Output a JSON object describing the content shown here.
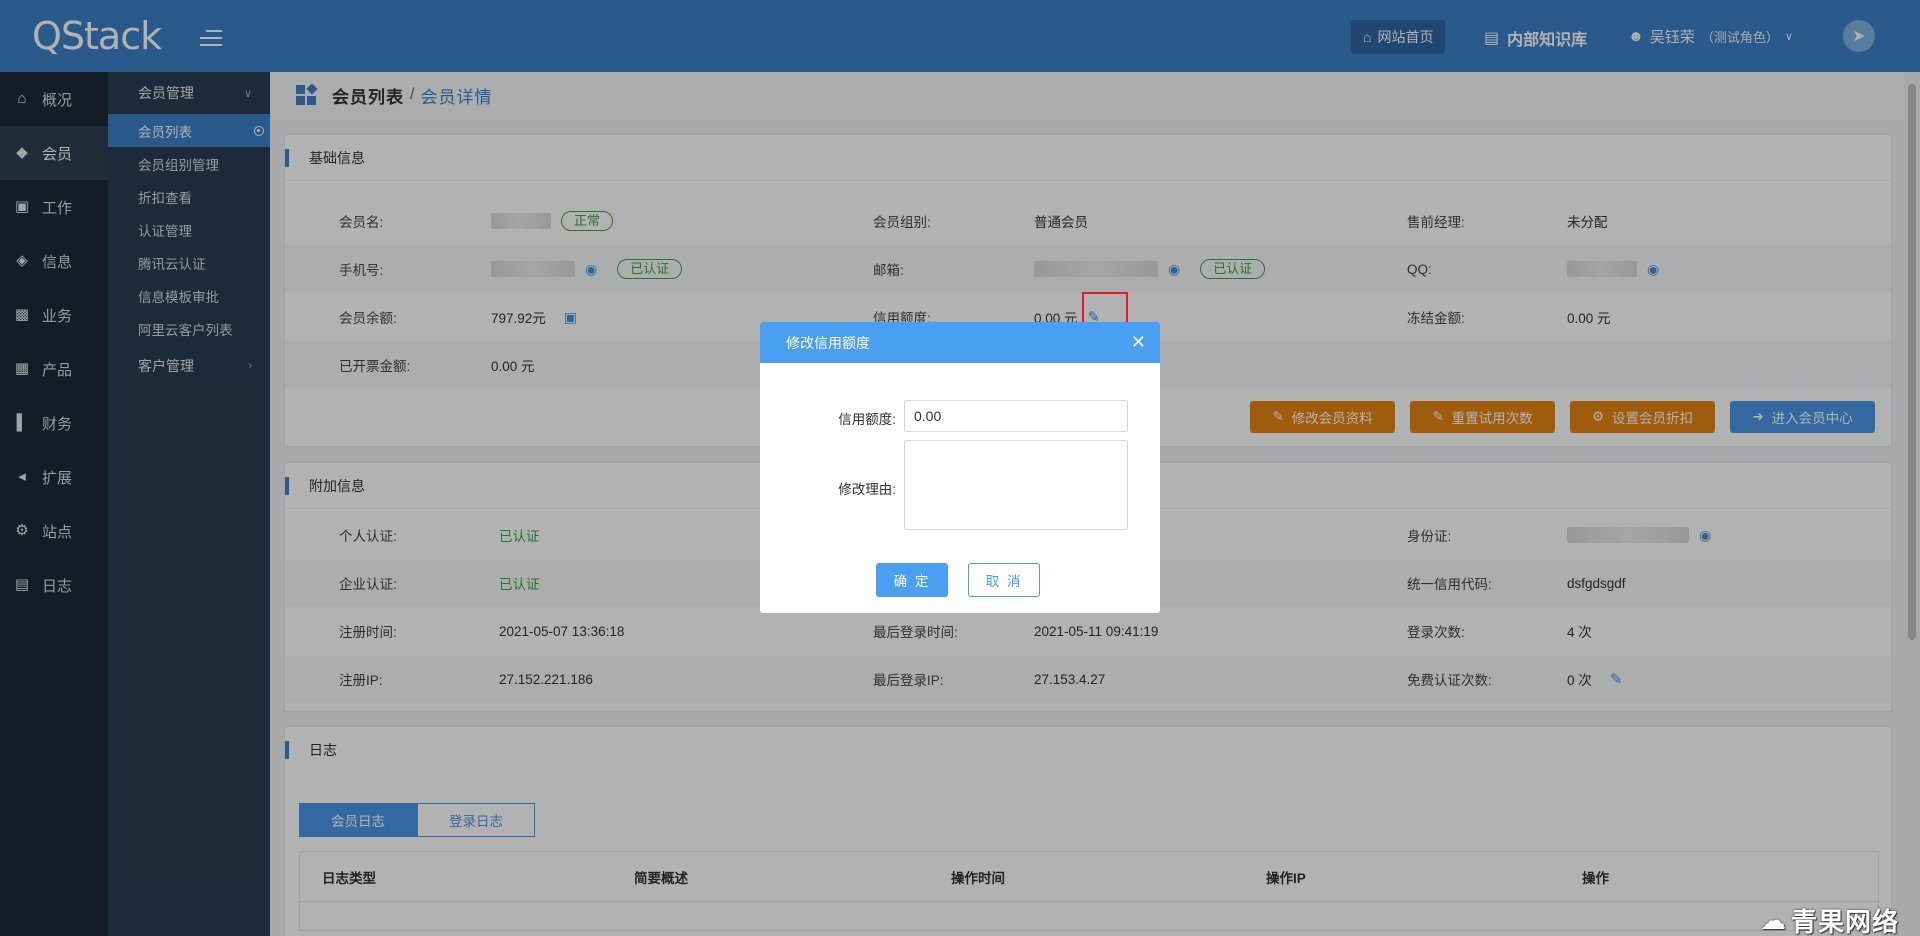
{
  "header": {
    "logo": "QStack",
    "home_button": "网站首页",
    "kb_link": "内部知识库",
    "user_name": "吴钰荣",
    "user_role": "（测试角色）"
  },
  "nav": {
    "items": [
      {
        "label": "概况",
        "icon": "home-icon"
      },
      {
        "label": "会员",
        "icon": "diamond-icon"
      },
      {
        "label": "工作",
        "icon": "clipboard-icon"
      },
      {
        "label": "信息",
        "icon": "cube-icon"
      },
      {
        "label": "业务",
        "icon": "briefcase-icon"
      },
      {
        "label": "产品",
        "icon": "cubes-icon"
      },
      {
        "label": "财务",
        "icon": "chart-icon"
      },
      {
        "label": "扩展",
        "icon": "arrows-icon"
      },
      {
        "label": "站点",
        "icon": "gear-icon"
      },
      {
        "label": "日志",
        "icon": "log-icon"
      }
    ]
  },
  "submenu": {
    "group1": "会员管理",
    "items": [
      "会员列表",
      "会员组别管理",
      "折扣查看",
      "认证管理",
      "腾讯云认证",
      "信息模板审批",
      "阿里云客户列表"
    ],
    "group2": "客户管理"
  },
  "breadcrumb": {
    "parent": "会员列表",
    "separator": "/",
    "current": "会员详情"
  },
  "basic": {
    "title": "基础信息",
    "member_name_label": "会员名:",
    "status_tag": "正常",
    "group_label": "会员组别:",
    "group_value": "普通会员",
    "manager_label": "售前经理:",
    "manager_value": "未分配",
    "phone_label": "手机号:",
    "verified_tag": "已认证",
    "email_label": "邮箱:",
    "qq_label": "QQ:",
    "balance_label": "会员余额:",
    "balance_value": "797.92元",
    "credit_label": "信用额度:",
    "credit_value": "0.00 元",
    "frozen_label": "冻结金额:",
    "frozen_value": "0.00 元",
    "invoiced_label": "已开票金额:",
    "invoiced_value": "0.00 元",
    "buttons": [
      "修改会员资料",
      "重置试用次数",
      "设置会员折扣",
      "进入会员中心"
    ]
  },
  "extra": {
    "title": "附加信息",
    "personal_label": "个人认证:",
    "personal_value": "已认证",
    "id_label": "身份证:",
    "enterprise_label": "企业认证:",
    "enterprise_value": "已认证",
    "credit_code_label": "统一信用代码:",
    "credit_code_value": "dsfgdsgdf",
    "reg_time_label": "注册时间:",
    "reg_time_value": "2021-05-07 13:36:18",
    "last_login_label": "最后登录时间:",
    "last_login_value": "2021-05-11 09:41:19",
    "login_count_label": "登录次数:",
    "login_count_value": "4 次",
    "reg_ip_label": "注册IP:",
    "reg_ip_value": "27.152.221.186",
    "last_ip_label": "最后登录IP:",
    "last_ip_value": "27.153.4.27",
    "free_verify_label": "免费认证次数:",
    "free_verify_value": "0 次"
  },
  "log": {
    "title": "日志",
    "tabs": [
      "会员日志",
      "登录日志"
    ],
    "columns": [
      "日志类型",
      "简要概述",
      "操作时间",
      "操作IP",
      "操作"
    ]
  },
  "dialog": {
    "title": "修改信用额度",
    "credit_label": "信用额度:",
    "credit_value": "0.00",
    "reason_label": "修改理由:",
    "ok": "确 定",
    "cancel": "取 消"
  },
  "watermark": "青果网络",
  "colors": {
    "header": "#3d82c9",
    "nav": "#1e2a38",
    "submenu": "#2a3d52",
    "accent": "#4b9ff0",
    "orange": "#e68413",
    "green": "#45a245"
  }
}
